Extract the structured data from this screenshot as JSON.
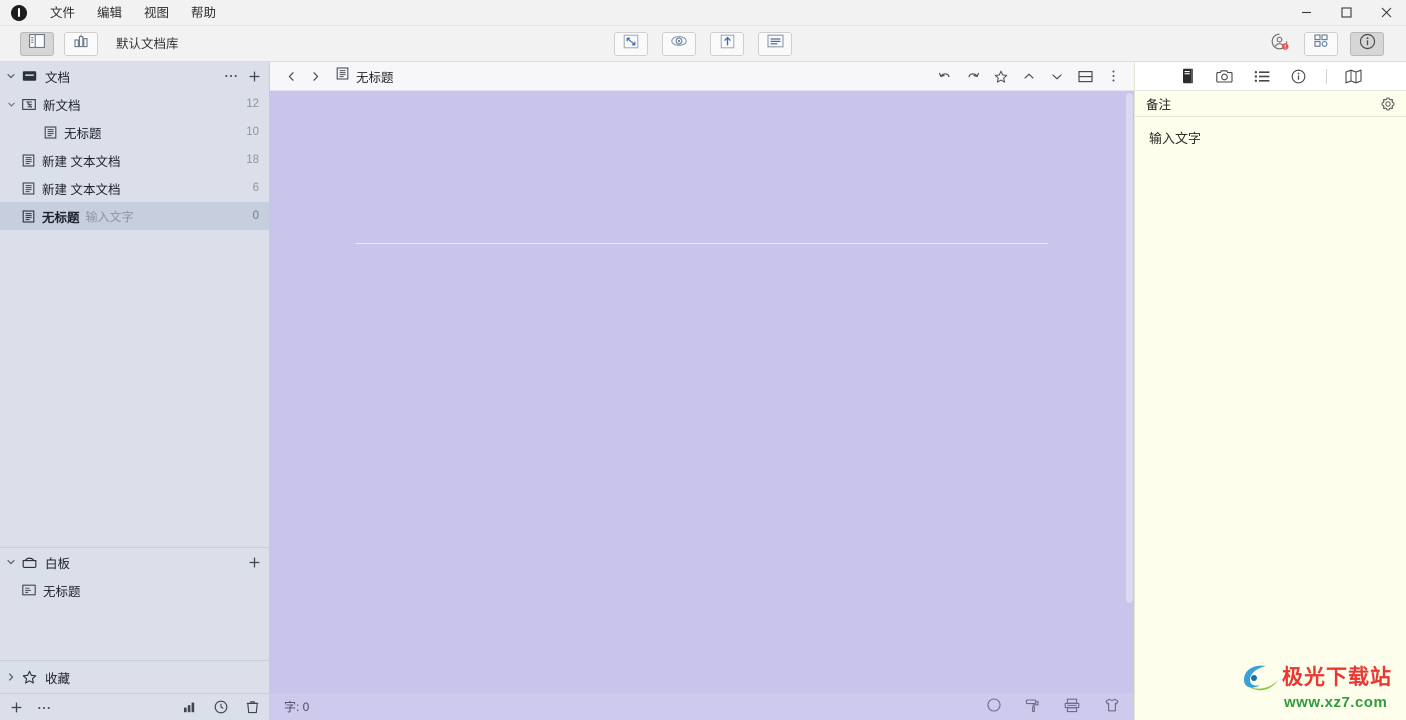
{
  "window": {
    "menu": [
      "文件",
      "编辑",
      "视图",
      "帮助"
    ],
    "controls": {
      "minimize": "minimize-icon",
      "maximize": "maximize-icon",
      "close": "close-icon"
    }
  },
  "toolbar": {
    "left": [
      {
        "name": "layout-panel-toggle",
        "icon": "sidebar-layout-icon",
        "pressed": true
      },
      {
        "name": "dashboard-toggle",
        "icon": "bar-chart-icon",
        "pressed": false
      }
    ],
    "library_label": "默认文档库",
    "center": [
      {
        "name": "fullscreen-button",
        "icon": "expand-arrows-icon"
      },
      {
        "name": "preview-button",
        "icon": "eye-icon"
      },
      {
        "name": "export-button",
        "icon": "upload-arrow-icon"
      },
      {
        "name": "outline-button",
        "icon": "lines-list-icon"
      }
    ],
    "right": [
      {
        "name": "account-button",
        "icon": "user-circle-icon",
        "badge": true
      },
      {
        "name": "apps-grid-button",
        "icon": "grid-apps-icon"
      },
      {
        "name": "info-button",
        "icon": "info-circle-icon",
        "pressed": true
      }
    ]
  },
  "sidebar": {
    "docs_section": {
      "label": "文档",
      "more_icon": "ellipsis-icon",
      "add_icon": "plus-icon"
    },
    "tree": [
      {
        "label": "新文档",
        "count": "12",
        "icon": "folder-doc-icon",
        "depth": 1,
        "caret": "chevron-down-icon",
        "selected": false
      },
      {
        "label": "无标题",
        "count": "10",
        "icon": "document-icon",
        "depth": 2,
        "caret": "",
        "selected": false
      },
      {
        "label": "新建 文本文档",
        "count": "18",
        "icon": "document-icon",
        "depth": 1,
        "caret": "",
        "selected": false
      },
      {
        "label": "新建 文本文档",
        "count": "6",
        "icon": "document-icon",
        "depth": 1,
        "caret": "",
        "selected": false
      },
      {
        "label": "无标题",
        "sub": "输入文字",
        "count": "0",
        "icon": "document-icon",
        "depth": 1,
        "caret": "",
        "selected": true
      }
    ],
    "whiteboard_section": {
      "label": "白板",
      "add_icon": "plus-icon",
      "items": [
        {
          "label": "无标题",
          "icon": "whiteboard-icon"
        }
      ]
    },
    "favorites_section": {
      "label": "收藏",
      "caret": "chevron-right-icon",
      "icon": "star-icon"
    },
    "bottom_bar": [
      {
        "name": "sidebar-add-button",
        "icon": "plus-icon"
      },
      {
        "name": "sidebar-more-button",
        "icon": "ellipsis-icon"
      },
      {
        "name": "sidebar-stats-button",
        "icon": "bar-chart-icon"
      },
      {
        "name": "sidebar-history-button",
        "icon": "clock-icon"
      },
      {
        "name": "sidebar-trash-button",
        "icon": "trash-icon"
      }
    ]
  },
  "editor": {
    "nav": {
      "back_icon": "chevron-left-icon",
      "forward_icon": "chevron-right-icon"
    },
    "doc_icon": "document-icon",
    "doc_title": "无标题",
    "actions": [
      {
        "name": "undo-button",
        "icon": "undo-arrow-icon"
      },
      {
        "name": "redo-button",
        "icon": "redo-arrow-icon"
      },
      {
        "name": "favorite-button",
        "icon": "star-icon"
      },
      {
        "name": "scroll-up-button",
        "icon": "chevron-up-icon"
      },
      {
        "name": "scroll-down-button",
        "icon": "chevron-down-icon"
      },
      {
        "name": "split-view-button",
        "icon": "split-pane-icon"
      },
      {
        "name": "more-options-button",
        "icon": "vertical-ellipsis-icon"
      }
    ],
    "canvas_bg": "#c8c4ec",
    "status": {
      "word_count_label": "字: 0",
      "right_icons": [
        {
          "name": "status-circle-button",
          "icon": "circle-icon"
        },
        {
          "name": "paint-roller-button",
          "icon": "paint-roller-icon"
        },
        {
          "name": "typewriter-button",
          "icon": "typewriter-icon"
        },
        {
          "name": "theme-shirt-button",
          "icon": "t-shirt-icon"
        }
      ]
    }
  },
  "right_panel": {
    "tabs": [
      {
        "name": "tab-notes",
        "icon": "book-icon",
        "active": true
      },
      {
        "name": "tab-camera",
        "icon": "camera-icon",
        "active": false
      },
      {
        "name": "tab-list",
        "icon": "list-icon",
        "active": false
      },
      {
        "name": "tab-info",
        "icon": "info-circle-icon",
        "active": false
      },
      {
        "name": "tab-map",
        "icon": "map-icon",
        "active": false
      }
    ],
    "header_title": "备注",
    "gear_icon": "gear-icon",
    "body_text": "输入文字",
    "bg_color": "#fdfeec"
  },
  "watermark": {
    "title": "极光下载站",
    "url": "www.xz7.com"
  }
}
